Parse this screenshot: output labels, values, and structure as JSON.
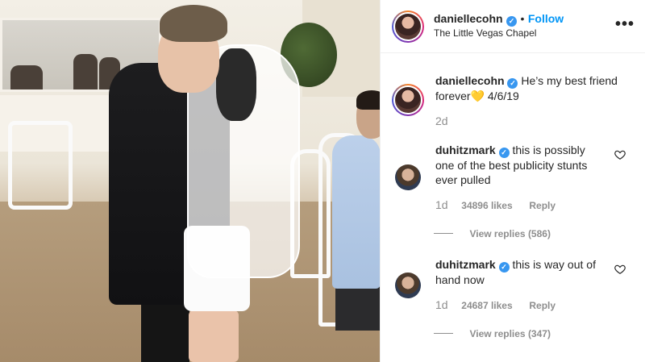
{
  "post": {
    "username": "daniellecohn",
    "verified_mark": "✓",
    "separator": "•",
    "follow_label": "Follow",
    "location": "The Little Vegas Chapel",
    "more_label": "•••"
  },
  "caption": {
    "username": "daniellecohn",
    "text_line1": "He’s my best friend",
    "text_line2": "forever💛  4/6/19",
    "time": "2d"
  },
  "comments": [
    {
      "username": "duhitzmark",
      "text_line1": "this is possibly",
      "text_line2": "one of the best publicity stunts",
      "text_line3": "ever pulled",
      "time": "1d",
      "likes": "34896 likes",
      "reply_label": "Reply",
      "view_replies": "View replies (586)"
    },
    {
      "username": "duhitzmark",
      "text_line1": "this is way out of",
      "text_line2": "hand now",
      "time": "1d",
      "likes": "24687 likes",
      "reply_label": "Reply",
      "view_replies": "View replies (347)"
    }
  ],
  "icons": {
    "verified": "verified-badge-icon",
    "heart": "heart-outline-icon",
    "more": "more-options-icon"
  },
  "colors": {
    "accent": "#0095f6",
    "verified": "#3897f0",
    "text": "#262626",
    "muted": "#8e8e8e"
  }
}
